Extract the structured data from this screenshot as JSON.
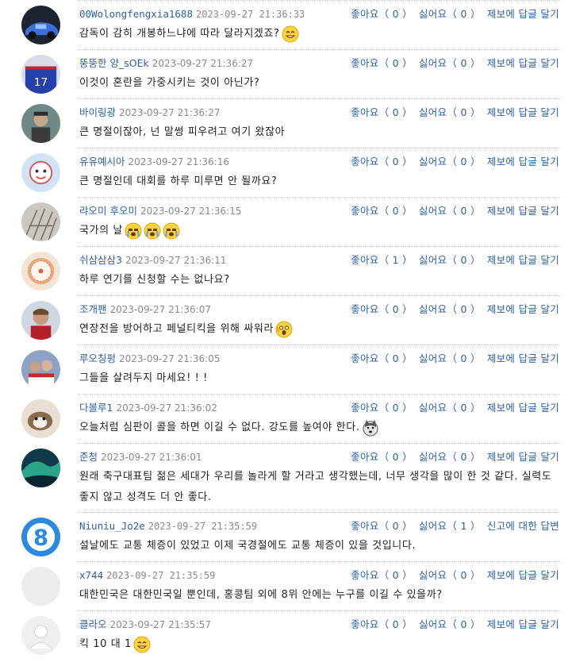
{
  "comments": [
    {
      "username": "00Wolongfengxia1688",
      "time": "2023-09-27 21:36:33",
      "text": "감독이 감히 개봉하느냐에 따라 달라지겠죠?",
      "emojis": [
        "grin-emoji"
      ],
      "likes": "0",
      "dislikes": "0",
      "report": "제보",
      "reply": "답글 달기",
      "avatar": "car-avatar",
      "mono": true,
      "height": 62
    },
    {
      "username": "뚱뚱한 양_sOEk",
      "time": "2023-09-27 21:36:27",
      "text": "이것이 혼란을 가중시키는 것이 아닌가?",
      "emojis": [],
      "likes": "0",
      "dislikes": "0",
      "report": "제보",
      "reply": "답글 달기",
      "avatar": "jersey-avatar",
      "height": 62
    },
    {
      "username": "바이링광",
      "time": "2023-09-27 21:36:27",
      "text": "큰 명절이잖아, 넌 말썽 피우려고 여기 왔잖아",
      "emojis": [],
      "likes": "0",
      "dislikes": "0",
      "report": "제보",
      "reply": "답글 달기",
      "avatar": "portrait-avatar",
      "height": 62
    },
    {
      "username": "유유예시아",
      "time": "2023-09-27 21:36:16",
      "text": "큰 명절인데 대회를 하루 미루면 안 될까요?",
      "emojis": [],
      "likes": "0",
      "dislikes": "0",
      "report": "제보",
      "reply": "답글 달기",
      "avatar": "cartoon-avatar",
      "height": 62
    },
    {
      "username": "랴오미 후오미",
      "time": "2023-09-27 21:36:15",
      "text": "국가의 날",
      "emojis": [
        "crying-emoji",
        "crying-emoji",
        "crying-emoji"
      ],
      "likes": "0",
      "dislikes": "0",
      "report": "제보",
      "reply": "답글 달기",
      "avatar": "branches-avatar",
      "height": 62
    },
    {
      "username": "쉬삼삼삼3",
      "time": "2023-09-27 21:36:11",
      "text": "하루 연기를 신청할 수는 없나요?",
      "emojis": [],
      "likes": "1",
      "dislikes": "0",
      "report": "제보",
      "reply": "답글 달기",
      "avatar": "cookie-avatar",
      "height": 62
    },
    {
      "username": "조개팬",
      "time": "2023-09-27 21:36:07",
      "text": "연장전을 방어하고 페널티킥을 위해 싸워라",
      "emojis": [
        "shocked-emoji"
      ],
      "likes": "0",
      "dislikes": "0",
      "report": "제보",
      "reply": "답글 달기",
      "avatar": "player-avatar",
      "height": 62
    },
    {
      "username": "루오칭펑",
      "time": "2023-09-27 21:36:05",
      "text": "그들을 살려두지 마세요! ! !",
      "emojis": [],
      "likes": "0",
      "dislikes": "0",
      "report": "제보",
      "reply": "답글 달기",
      "avatar": "crowd-avatar",
      "height": 62
    },
    {
      "username": "다볼루1",
      "time": "2023-09-27 21:36:02",
      "text": "오늘처럼 심판이 콜을 하면 이길 수 없다. 강도를 높여야 한다.",
      "emojis": [
        "husky-emoji"
      ],
      "likes": "0",
      "dislikes": "0",
      "report": "제보",
      "reply": "답글 달기",
      "avatar": "cat-avatar",
      "height": 62
    },
    {
      "username": "준청",
      "time": "2023-09-27 21:36:01",
      "text": "원래 축구대표팀 젊은 세대가 우리를 놀라게 할 거라고 생각했는데, 너무 생각을 많이 한 것 같다. 실력도 좋지 않고 성격도 더 안 좋다.",
      "emojis": [],
      "likes": "0",
      "dislikes": "0",
      "report": "제보",
      "reply": "답글 달기",
      "avatar": "aurora-avatar",
      "height": 87
    },
    {
      "username": "Niuniu_Jo2e",
      "time": "2023-09-27 21:35:59",
      "text": "설날에도 교통 체증이 있었고 이제 국경절에도 교통 체증이 있을 것입니다.",
      "emojis": [],
      "likes": "0",
      "dislikes": "1",
      "report": "신고",
      "reply": "대한 답변",
      "report_prefix": "에",
      "avatar": "number8-avatar",
      "mono": true,
      "height": 62
    },
    {
      "username": "x744",
      "time": "2023-09-27 21:35:59",
      "text": "대한민국은 대한민국일 뿐인데, 홍콩팀 외에 8위 안에는 누구를 이길 수 있을까?",
      "emojis": [],
      "likes": "0",
      "dislikes": "0",
      "report": "제보",
      "reply": "답글 달기",
      "avatar": "blank-avatar",
      "mono": true,
      "height": 62
    },
    {
      "username": "클라오",
      "time": "2023-09-27 21:35:57",
      "text": "킥 10 대 1",
      "emojis": [
        "grin-emoji"
      ],
      "likes": "0",
      "dislikes": "0",
      "report": "제보",
      "reply": "답글 달기",
      "avatar": "default-user-avatar",
      "height": 70
    }
  ],
  "labels": {
    "like": "좋아요",
    "dislike": "싫어요",
    "report_suffix": "에"
  },
  "colors": {
    "link": "#2b62a8",
    "time": "#8a8a8a",
    "text": "#222222",
    "divider": "#c8c8c8"
  }
}
